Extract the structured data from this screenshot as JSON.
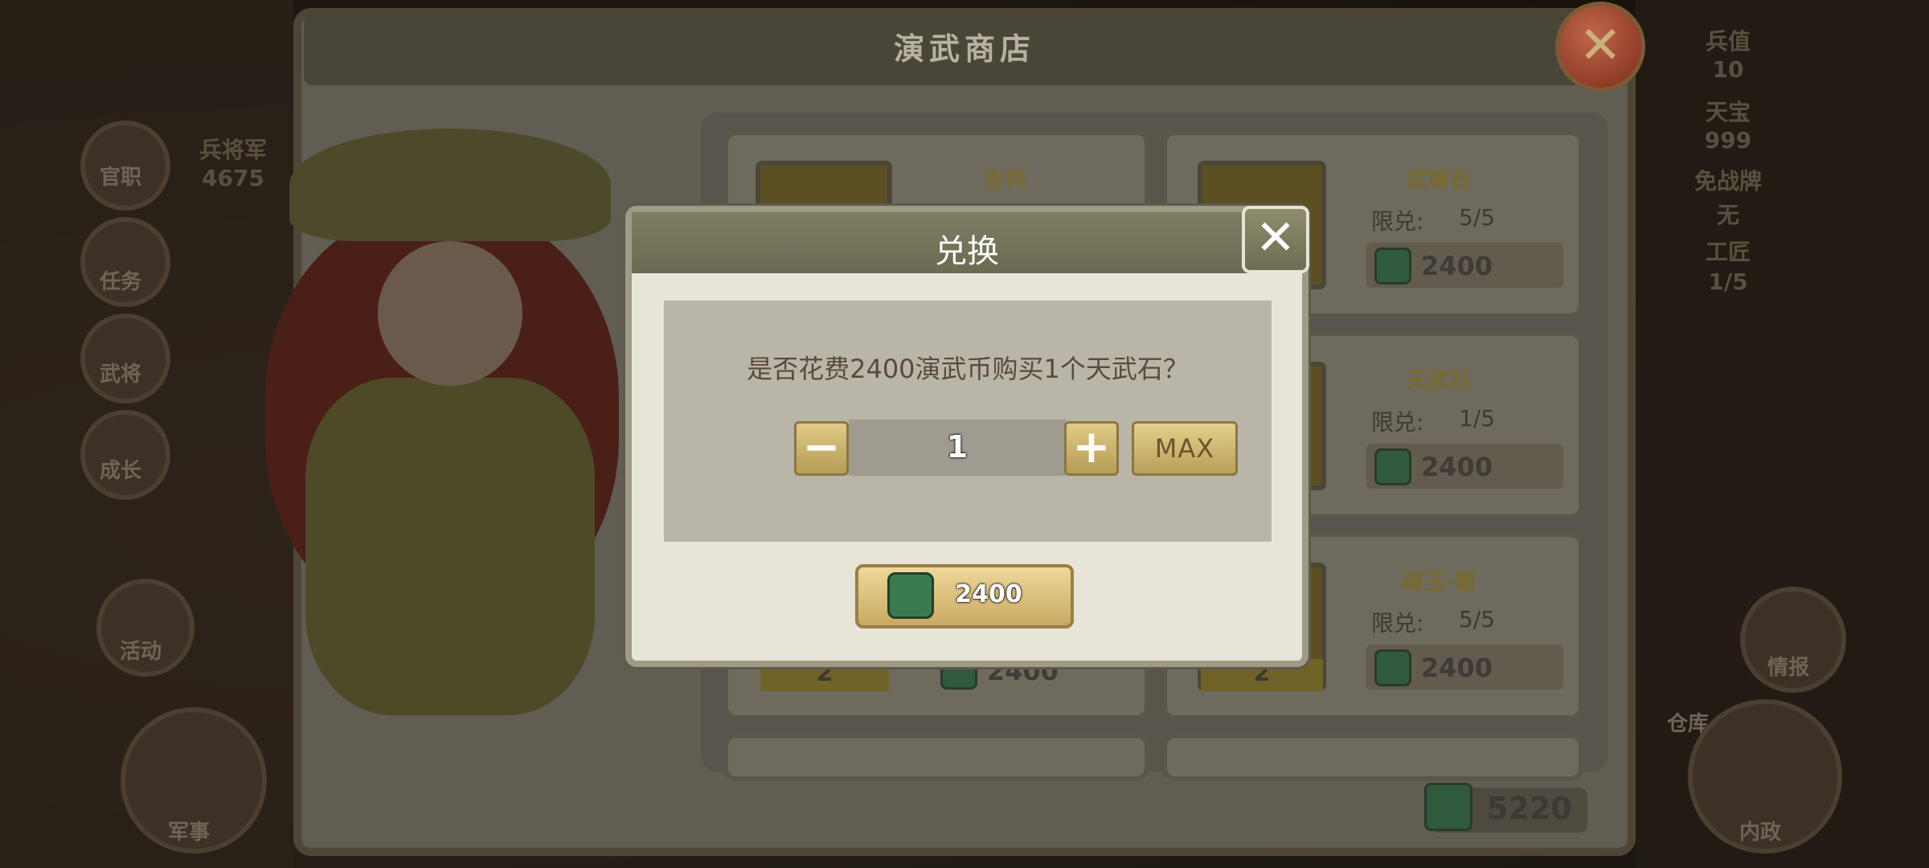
{
  "left_sidebar": {
    "items": [
      {
        "label": "官职"
      },
      {
        "label": "任务"
      },
      {
        "label": "武将"
      },
      {
        "label": "成长"
      },
      {
        "label": "活动"
      },
      {
        "label": "军事"
      }
    ],
    "stats": {
      "army_label": "兵将军",
      "army_value": "4675"
    }
  },
  "right_sidebar": {
    "stats": [
      {
        "label": "兵值",
        "value": "10"
      },
      {
        "label": "天宝",
        "value": "999"
      },
      {
        "label": "免战牌",
        "value": "无"
      },
      {
        "label": "工匠",
        "value": "1/5"
      }
    ],
    "items": [
      {
        "label": "情报"
      },
      {
        "label": "仓库"
      },
      {
        "label": "内政"
      }
    ]
  },
  "shop": {
    "title": "演武商店",
    "items": [
      {
        "name": "吉祥",
        "limit_label": "",
        "limit": "",
        "price": "",
        "count": ""
      },
      {
        "name": "武尊石",
        "limit_label": "限兑:",
        "limit": "5/5",
        "price": "2400",
        "count": ""
      },
      {
        "name": "",
        "limit_label": "",
        "limit": "",
        "price": "",
        "count": ""
      },
      {
        "name": "天武石",
        "limit_label": "限兑:",
        "limit": "1/5",
        "price": "2400",
        "count": ""
      },
      {
        "name": "",
        "limit_label": "",
        "limit": "",
        "price": "2400",
        "count": "2"
      },
      {
        "name": "魂玉-蜀",
        "limit_label": "限兑:",
        "limit": "5/5",
        "price": "2400",
        "count": "2"
      }
    ],
    "currency_balance": "5220"
  },
  "modal": {
    "title": "兑换",
    "question": "是否花费2400演武币购买1个天武石？",
    "quantity": "1",
    "minus_label": "−",
    "plus_label": "+",
    "max_label": "MAX",
    "buy_price": "2400",
    "close_glyph": "✕"
  },
  "icons": {
    "currency": "jade-mask-coin-icon",
    "close": "close-icon"
  }
}
